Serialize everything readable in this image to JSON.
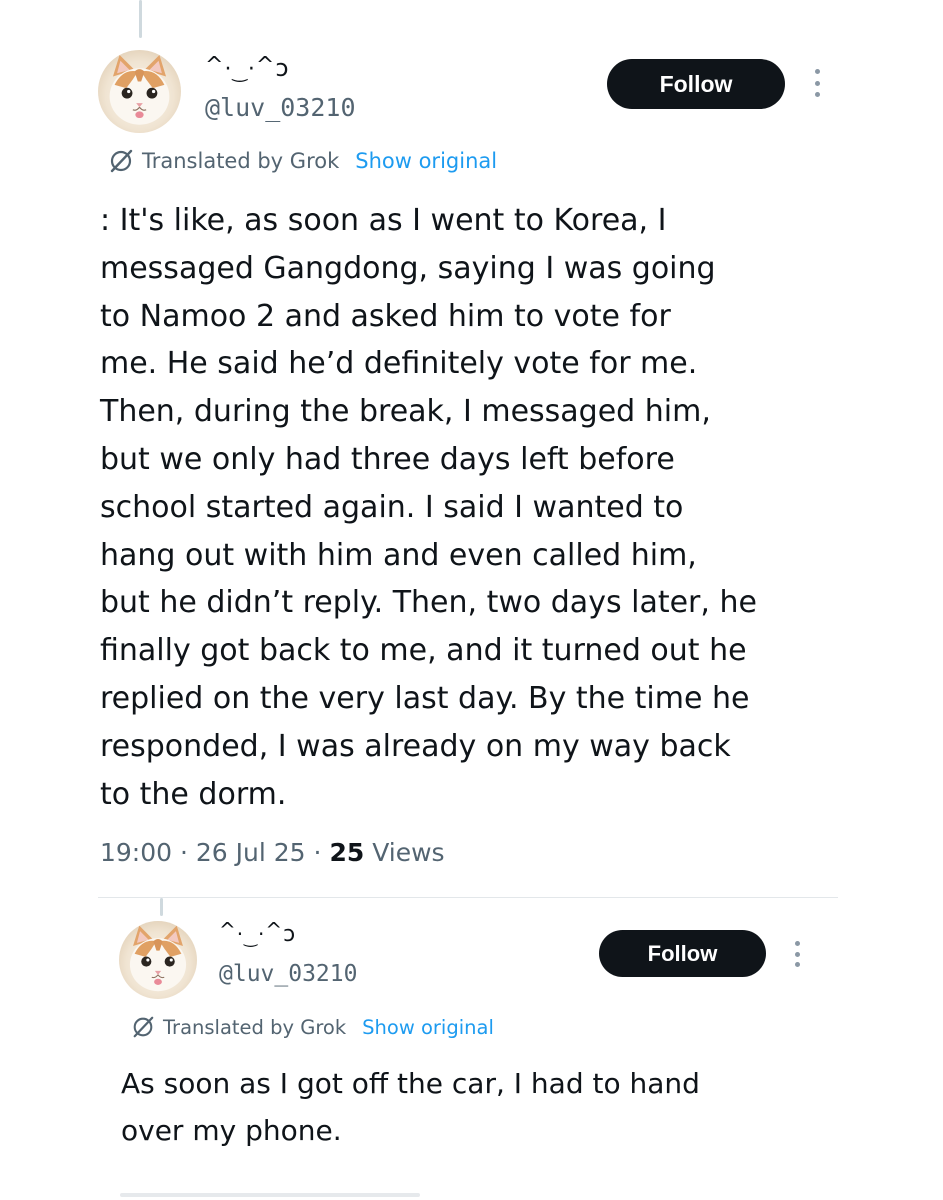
{
  "tweets": [
    {
      "display_name": "^..^ↄ",
      "display_name_html": "<span style='position:relative'>^</span>",
      "handle": "@luv_03210",
      "follow_label": "Follow",
      "translated_label": "Translated by Grok",
      "show_original_label": "Show original",
      "text": ": It's like, as soon as I went to Korea, I\nmessaged Gangdong, saying I was going\nto Namoo 2 and asked him to vote for\nme. He said he’d definitely vote for me.\nThen, during the break, I messaged him,\nbut we only had three days left before\nschool started again. I said I wanted to\nhang out with him and even called him,\nbut he didn’t reply. Then, two days later, he\nfinally got back to me, and it turned out he\nreplied on the very last day. By the time he\nresponded, I was already on my way back\nto the dorm.",
      "time": "19:00",
      "date": "26 Jul 25",
      "views_count": "25",
      "views_label": "Views"
    },
    {
      "display_name": "^..^ↄ",
      "handle": "@luv_03210",
      "follow_label": "Follow",
      "translated_label": "Translated by Grok",
      "show_original_label": "Show original",
      "text": "As soon as I got off the car, I had to hand\nover my phone."
    }
  ],
  "icons": {
    "avatar": "cat-avatar-icon",
    "more": "more-options-icon",
    "translate": "grok-translate-icon"
  },
  "colors": {
    "follow_bg": "#0f1419",
    "link_blue": "#1d9bf0",
    "secondary_text": "#536471"
  }
}
